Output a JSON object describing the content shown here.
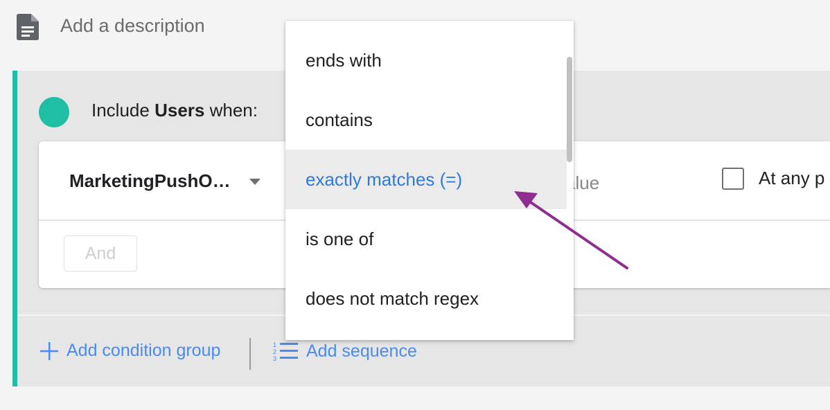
{
  "description": {
    "placeholder": "Add a description",
    "icon": "document-icon"
  },
  "group": {
    "include_prefix": "Include",
    "include_subject": "Users",
    "include_suffix": "when:",
    "accent_color": "#1fbfa6"
  },
  "condition": {
    "dimension": "MarketingPushO…",
    "value_placeholder": "alue",
    "checkbox_label": "At any p",
    "checkbox_checked": false,
    "and_label": "And"
  },
  "actions": {
    "add_condition_group": "Add condition group",
    "add_sequence": "Add sequence",
    "link_color": "#4a8af4"
  },
  "dropdown": {
    "options": [
      {
        "label": "ends with"
      },
      {
        "label": "contains"
      },
      {
        "label": "exactly matches (=)",
        "selected": true
      },
      {
        "label": "is one of"
      },
      {
        "label": "does not match regex"
      }
    ]
  },
  "annotation": {
    "color": "#8e2c8f",
    "target_option": "exactly matches (=)"
  }
}
